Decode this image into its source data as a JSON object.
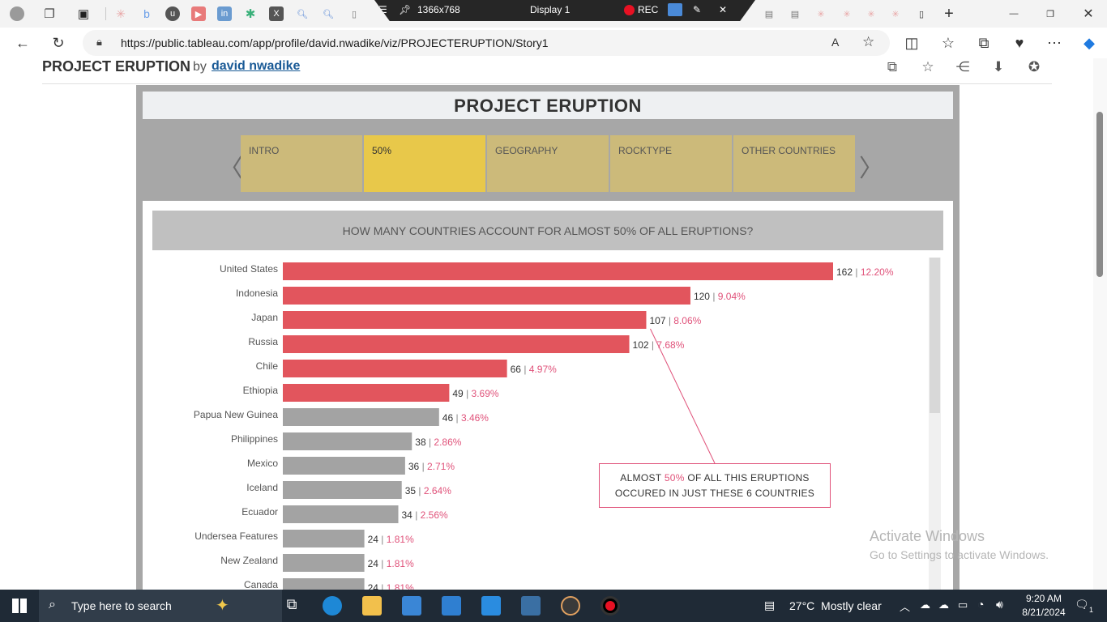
{
  "browser": {
    "url": "https://public.tableau.com/app/profile/david.nwadike/viz/PROJECTERUPTION/Story1"
  },
  "recorder": {
    "resolution": "1366x768",
    "display": "Display 1",
    "rec_label": "REC"
  },
  "viz_header": {
    "title": "PROJECT ERUPTION",
    "by": "by",
    "author": "david nwadike"
  },
  "story": {
    "title": "PROJECT ERUPTION",
    "tabs": [
      {
        "label": "INTRO"
      },
      {
        "label": "50%"
      },
      {
        "label": "GEOGRAPHY"
      },
      {
        "label": "ROCKTYPE"
      },
      {
        "label": "OTHER COUNTRIES"
      }
    ],
    "active_tab": "50%",
    "question": "HOW MANY COUNTRIES ACCOUNT FOR ALMOST 50% OF ALL ERUPTIONS?"
  },
  "callout": {
    "prefix": "ALMOST ",
    "pct": "50%",
    "mid": " OF ALL THIS ERUPTIONS",
    "line2": "OCCURED IN JUST THESE 6 COUNTRIES"
  },
  "chart_data": {
    "type": "bar",
    "orientation": "horizontal",
    "highlight_color": "#e2555d",
    "base_color": "#a3a3a3",
    "pct_color": "#e0527a",
    "highlight_count": 6,
    "xlim": [
      0,
      162
    ],
    "categories": [
      "United States",
      "Indonesia",
      "Japan",
      "Russia",
      "Chile",
      "Ethiopia",
      "Papua New Guinea",
      "Philippines",
      "Mexico",
      "Iceland",
      "Ecuador",
      "Undersea Features",
      "New Zealand",
      "Canada"
    ],
    "values": [
      162,
      120,
      107,
      102,
      66,
      49,
      46,
      38,
      36,
      35,
      34,
      24,
      24,
      24
    ],
    "pct_labels": [
      "12.20%",
      "9.04%",
      "8.06%",
      "7.68%",
      "4.97%",
      "3.69%",
      "3.46%",
      "2.86%",
      "2.71%",
      "2.64%",
      "2.56%",
      "1.81%",
      "1.81%",
      "1.81%"
    ]
  },
  "watermark": {
    "line1": "Activate Windows",
    "line2": "Go to Settings to activate Windows."
  },
  "taskbar": {
    "search_placeholder": "Type here to search",
    "weather": "27°C  Mostly clear",
    "time": "9:20 AM",
    "date": "8/21/2024",
    "notifications": "1"
  }
}
